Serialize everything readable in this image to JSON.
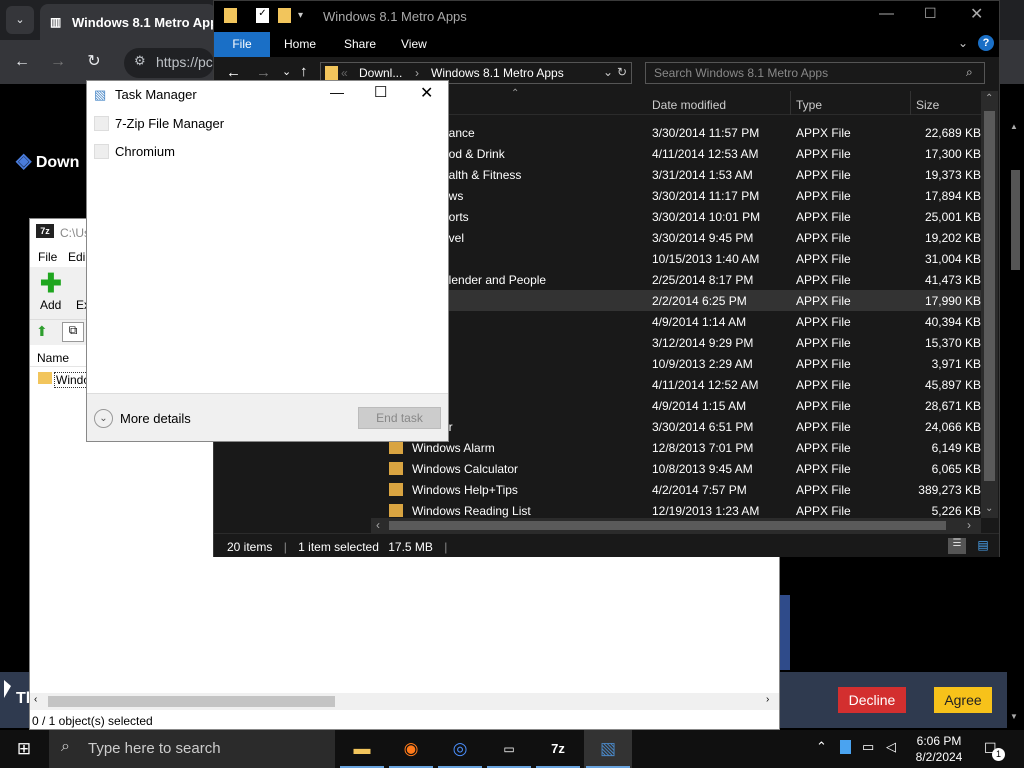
{
  "browser": {
    "tab_title": "Windows 8.1 Metro Apps",
    "omnibox_text": "https://pc",
    "site_logo": "Down",
    "banner_text": "Tl",
    "decline_label": "Decline",
    "agree_label": "Agree"
  },
  "sevenzip": {
    "title": "C:\\Us",
    "menu": [
      "File",
      "Edi"
    ],
    "add_label": "Add",
    "extract_label": "Ex",
    "col_name": "Name",
    "row_name": "Windo",
    "status": "0 / 1 object(s) selected"
  },
  "explorer": {
    "title": "Windows 8.1 Metro Apps",
    "ribbon_tabs": [
      "File",
      "Home",
      "Share",
      "View"
    ],
    "address_parent": "Downl...",
    "address_current": "Windows 8.1 Metro Apps",
    "search_placeholder": "Search Windows 8.1 Metro Apps",
    "columns": {
      "date": "Date modified",
      "type": "Type",
      "size": "Size"
    },
    "rows": [
      {
        "name": "nance",
        "date": "3/30/2014 11:57 PM",
        "type": "APPX File",
        "size": "22,689 KB"
      },
      {
        "name": "ood & Drink",
        "date": "4/11/2014 12:53 AM",
        "type": "APPX File",
        "size": "17,300 KB"
      },
      {
        "name": "ealth & Fitness",
        "date": "3/31/2014 1:53 AM",
        "type": "APPX File",
        "size": "19,373 KB"
      },
      {
        "name": "ews",
        "date": "3/30/2014 11:17 PM",
        "type": "APPX File",
        "size": "17,894 KB"
      },
      {
        "name": "ports",
        "date": "3/30/2014 10:01 PM",
        "type": "APPX File",
        "size": "25,001 KB"
      },
      {
        "name": "avel",
        "date": "3/30/2014 9:45 PM",
        "type": "APPX File",
        "size": "19,202 KB"
      },
      {
        "name": "",
        "date": "10/15/2013 1:40 AM",
        "type": "APPX File",
        "size": "31,004 KB"
      },
      {
        "name": "alender and People",
        "date": "2/25/2014 8:17 PM",
        "type": "APPX File",
        "size": "41,473 KB"
      },
      {
        "name": "",
        "date": "2/2/2014 6:25 PM",
        "type": "APPX File",
        "size": "17,990 KB"
      },
      {
        "name": "",
        "date": "4/9/2014 1:14 AM",
        "type": "APPX File",
        "size": "40,394 KB"
      },
      {
        "name": "",
        "date": "3/12/2014 9:29 PM",
        "type": "APPX File",
        "size": "15,370 KB"
      },
      {
        "name": "",
        "date": "10/9/2013 2:29 AM",
        "type": "APPX File",
        "size": "3,971 KB"
      },
      {
        "name": "",
        "date": "4/11/2014 12:52 AM",
        "type": "APPX File",
        "size": "45,897 KB"
      },
      {
        "name": "",
        "date": "4/9/2014 1:15 AM",
        "type": "APPX File",
        "size": "28,671 KB"
      },
      {
        "name": "er",
        "date": "3/30/2014 6:51 PM",
        "type": "APPX File",
        "size": "24,066 KB"
      },
      {
        "name": "Windows Alarm",
        "date": "12/8/2013 7:01 PM",
        "type": "APPX File",
        "size": "6,149 KB"
      },
      {
        "name": "Windows Calculator",
        "date": "10/8/2013 9:45 AM",
        "type": "APPX File",
        "size": "6,065 KB"
      },
      {
        "name": "Windows Help+Tips",
        "date": "4/2/2014 7:57 PM",
        "type": "APPX File",
        "size": "389,273 KB"
      },
      {
        "name": "Windows Reading List",
        "date": "12/19/2013 1:23 AM",
        "type": "APPX File",
        "size": "5,226 KB"
      }
    ],
    "status_items": "20 items",
    "status_selected": "1 item selected",
    "status_size": "17.5 MB"
  },
  "taskmanager": {
    "title": "Task Manager",
    "items": [
      "7-Zip File Manager",
      "Chromium"
    ],
    "more_details": "More details",
    "end_task": "End task"
  },
  "taskbar": {
    "search_placeholder": "Type here to search",
    "time": "6:06 PM",
    "date": "8/2/2024",
    "notification_count": "1"
  }
}
